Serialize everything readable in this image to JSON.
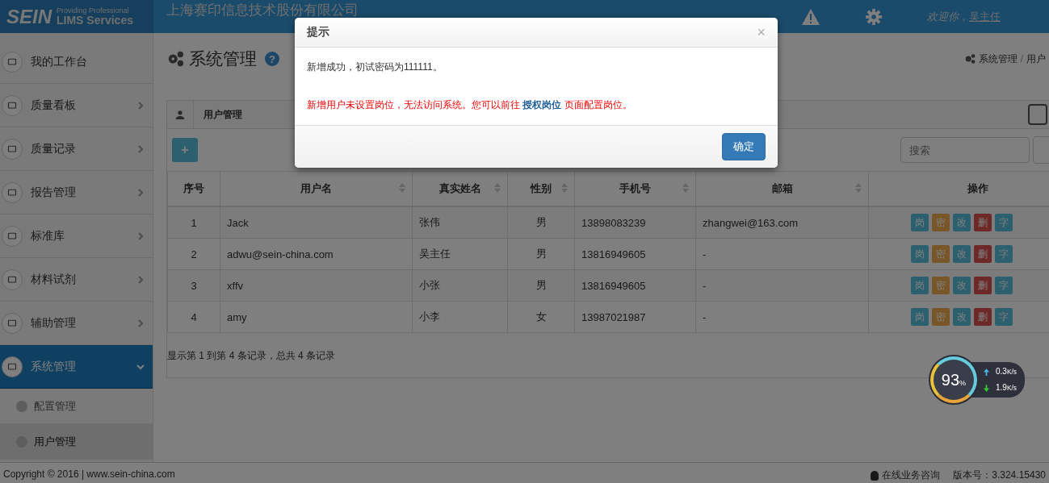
{
  "header": {
    "logo_word": "SEIN",
    "logo_tagline": "Providing Professional",
    "logo_product": "LIMS Services",
    "title": "上海赛印信息技术股份有限公司",
    "welcome": "欢迎你，",
    "user": "吴主任"
  },
  "sidebar": {
    "items": [
      {
        "label": "我的工作台",
        "has_children": false,
        "expanded": false,
        "selected": false
      },
      {
        "label": "质量看板",
        "has_children": true,
        "expanded": false,
        "selected": false
      },
      {
        "label": "质量记录",
        "has_children": true,
        "expanded": false,
        "selected": false
      },
      {
        "label": "报告管理",
        "has_children": true,
        "expanded": false,
        "selected": false
      },
      {
        "label": "标准库",
        "has_children": true,
        "expanded": false,
        "selected": false
      },
      {
        "label": "材料试剂",
        "has_children": true,
        "expanded": false,
        "selected": false
      },
      {
        "label": "辅助管理",
        "has_children": true,
        "expanded": false,
        "selected": false
      },
      {
        "label": "系统管理",
        "has_children": true,
        "expanded": true,
        "selected": true,
        "children": [
          {
            "label": "配置管理",
            "selected": false
          },
          {
            "label": "用户管理",
            "selected": true
          }
        ]
      }
    ]
  },
  "page": {
    "title": "系统管理",
    "help": "?",
    "breadcrumb": [
      "系统管理",
      "用户"
    ],
    "breadcrumb_separator": "/"
  },
  "panel": {
    "title": "用户管理",
    "add_button": "+",
    "search": {
      "placeholder": "搜索"
    },
    "table": {
      "columns": [
        {
          "label": "序号",
          "sortable": false
        },
        {
          "label": "用户名",
          "sortable": true
        },
        {
          "label": "真实姓名",
          "sortable": true
        },
        {
          "label": "性别",
          "sortable": true
        },
        {
          "label": "手机号",
          "sortable": true
        },
        {
          "label": "邮箱",
          "sortable": true
        },
        {
          "label": "操作",
          "sortable": false
        }
      ],
      "rows": [
        {
          "cells": [
            "1",
            "Jack",
            "张伟",
            "男",
            "13898083239",
            "zhangwei@163.com"
          ],
          "actions": [
            {
              "label": "岗",
              "kind": "info"
            },
            {
              "label": "密",
              "kind": "warning"
            },
            {
              "label": "改",
              "kind": "info"
            },
            {
              "label": "删",
              "kind": "danger"
            },
            {
              "label": "字",
              "kind": "info"
            }
          ]
        },
        {
          "cells": [
            "2",
            "adwu@sein-china.com",
            "吴主任",
            "男",
            "13816949605",
            "-"
          ],
          "actions": [
            {
              "label": "岗",
              "kind": "info"
            },
            {
              "label": "密",
              "kind": "warning"
            },
            {
              "label": "改",
              "kind": "info"
            },
            {
              "label": "删",
              "kind": "danger"
            },
            {
              "label": "字",
              "kind": "info"
            }
          ]
        },
        {
          "cells": [
            "3",
            "xffv",
            "小张",
            "男",
            "13816949605",
            "-"
          ],
          "actions": [
            {
              "label": "岗",
              "kind": "info"
            },
            {
              "label": "密",
              "kind": "warning"
            },
            {
              "label": "改",
              "kind": "info"
            },
            {
              "label": "删",
              "kind": "danger"
            },
            {
              "label": "字",
              "kind": "info"
            }
          ]
        },
        {
          "cells": [
            "4",
            "amy",
            "小李",
            "女",
            "13987021987",
            "-"
          ],
          "actions": [
            {
              "label": "岗",
              "kind": "info"
            },
            {
              "label": "密",
              "kind": "warning"
            },
            {
              "label": "改",
              "kind": "info"
            },
            {
              "label": "删",
              "kind": "danger"
            },
            {
              "label": "字",
              "kind": "info"
            }
          ]
        }
      ]
    },
    "summary": "显示第 1 到第 4 条记录，总共 4 条记录"
  },
  "footer": {
    "copyright": "Copyright © 2016 | www.sein-china.com",
    "consult": "在线业务咨询",
    "version": "版本号：3.324.15430"
  },
  "net_widget": {
    "percent": "93",
    "percent_unit": "%",
    "up": "0.3",
    "up_unit": "K/s",
    "down": "1.9",
    "down_unit": "K/s"
  },
  "dialog": {
    "title": "提示",
    "close": "×",
    "message": "新增成功，初试密码为111111。",
    "warning_before": "新增用户未设置岗位，无法访问系统。您可以前往 ",
    "warning_link": "授权岗位",
    "warning_after": " 页面配置岗位。",
    "confirm": "确定"
  }
}
